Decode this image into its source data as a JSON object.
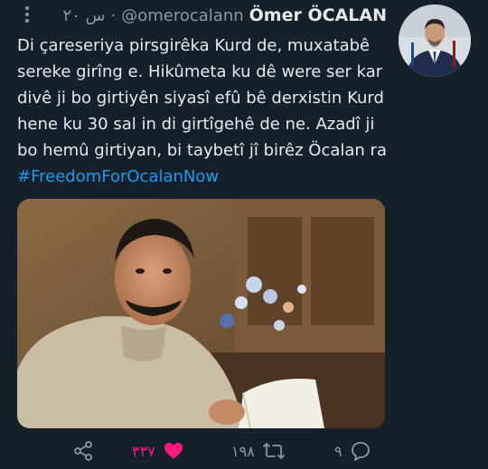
{
  "tweet": {
    "author_name": "Ömer ÖCALAN",
    "handle": "@omerocalann",
    "separator": "·",
    "time": "۲۰ س",
    "text_lines": [
      "Di çareseriya pirsgirêka Kurd de, muxatabê",
      "sereke girîng e. Hikûmeta ku dê were ser kar",
      "divê ji bo girtiyên siyasî efû bê derxistin Kurd",
      "hene ku 30 sal in di girtîgehê de ne. Azadî ji",
      "bo hemû girtiyan, bi taybetî jî birêz Öcalan ra"
    ],
    "hashtag": "#FreedomForOcalanNow"
  },
  "actions": {
    "likes": "۳۳۷",
    "retweets": "۱۹۸",
    "replies": "۹"
  },
  "icons": {
    "more": "more-dots-icon",
    "share": "share-icon",
    "like": "heart-filled-icon",
    "retweet": "retweet-icon",
    "reply": "reply-bubble-icon"
  },
  "colors": {
    "background": "#15202b",
    "text": "#e7e9ea",
    "muted": "#8b98a5",
    "link": "#1d9bf0",
    "like": "#f91880"
  }
}
